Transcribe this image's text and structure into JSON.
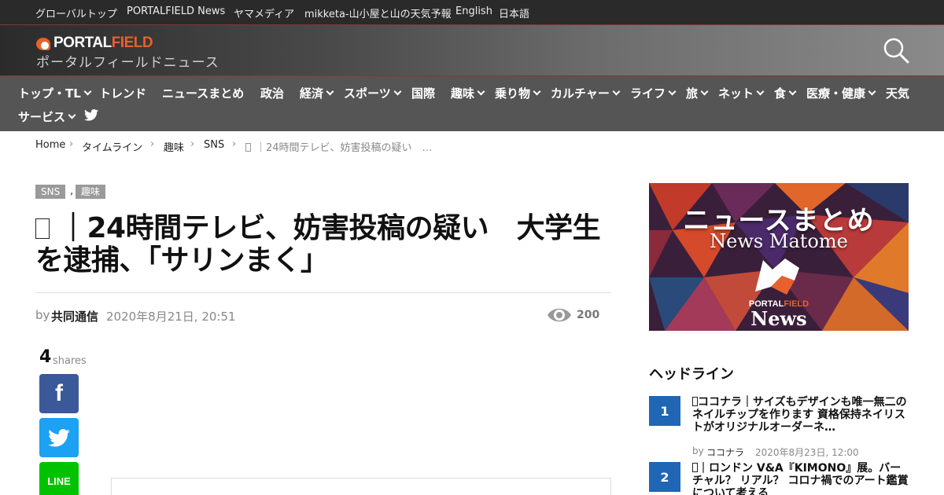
{
  "topbar": {
    "links": [
      "グローバルトップ",
      "PORTALFIELD News",
      "ヤマメディア",
      "mikketa-山小屋と山の天気予報",
      "English",
      "日本語"
    ]
  },
  "header": {
    "logo_main": "PORTAL",
    "logo_accent": "FIELD",
    "tagline": "ポータルフィールドニュース"
  },
  "nav": {
    "items": [
      {
        "label": "トップ・TL",
        "dropdown": true
      },
      {
        "label": "トレンド",
        "dropdown": false
      },
      {
        "label": "ニュースまとめ",
        "dropdown": false
      },
      {
        "label": "政治",
        "dropdown": false
      },
      {
        "label": "経済",
        "dropdown": true
      },
      {
        "label": "スポーツ",
        "dropdown": true
      },
      {
        "label": "国際",
        "dropdown": false
      },
      {
        "label": "趣味",
        "dropdown": true
      },
      {
        "label": "乗り物",
        "dropdown": true
      },
      {
        "label": "カルチャー",
        "dropdown": true
      },
      {
        "label": "ライフ",
        "dropdown": true
      },
      {
        "label": "旅",
        "dropdown": true
      },
      {
        "label": "ネット",
        "dropdown": true
      },
      {
        "label": "食",
        "dropdown": true
      },
      {
        "label": "医療・健康",
        "dropdown": true
      },
      {
        "label": "天気",
        "dropdown": false
      },
      {
        "label": "サービス",
        "dropdown": true
      }
    ]
  },
  "breadcrumb": [
    "Home",
    "タイムライン",
    "趣味",
    "SNS",
    "｜24時間テレビ、妨害投稿の疑い　…"
  ],
  "article": {
    "tags": [
      "SNS",
      "趣味"
    ],
    "tag_separator": ",",
    "title": "｜24時間テレビ、妨害投稿の疑い　大学生を逮捕、「サリンまく」",
    "by": "by",
    "author": "共同通信",
    "date": "2020年8月21日, 20:51",
    "views": "200",
    "shares_count": "4",
    "shares_label": "shares",
    "facebook_label": "f",
    "line_label": "LINE"
  },
  "sidebar": {
    "banner": {
      "title": "ニュースまとめ",
      "subtitle": "News Matome",
      "portal_main": "PORTAL",
      "portal_accent": "FIELD",
      "news": "News"
    },
    "heading": "ヘッドライン",
    "headlines": [
      {
        "rank": "1",
        "title": "ココナラ｜サイズもデザインも唯一無二のネイルチップを作ります 資格保持ネイリストがオリジナルオーダーネ…",
        "by": "by",
        "source": "ココナラ",
        "date": "2020年8月23日, 12:00"
      },
      {
        "rank": "2",
        "title": "｜ロンドン V&A『KIMONO』展。バーチャル？ リアル？ コロナ禍でのアート鑑賞について考える"
      }
    ]
  },
  "colors": {
    "topbar_bg": "#2a2a2a",
    "nav_bg": "#555555",
    "accent_orange": "#e8612c",
    "facebook": "#3b5998",
    "twitter": "#1da1f2",
    "line": "#00c300",
    "rank_blue": "#1f66b5"
  }
}
